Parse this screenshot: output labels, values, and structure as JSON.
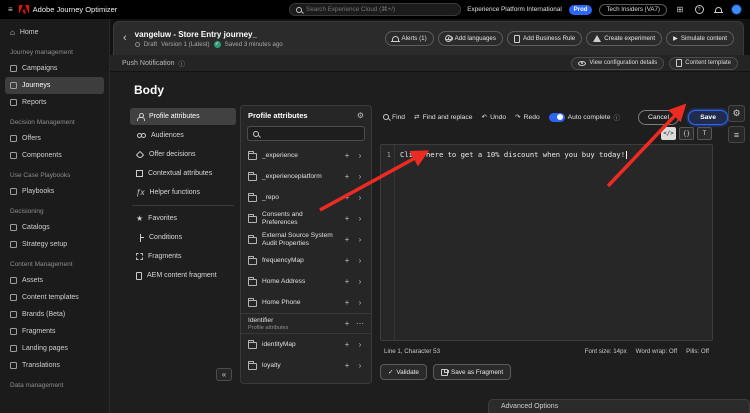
{
  "colors": {
    "accent_blue": "#2b66f6",
    "positive_green": "#2d9d78",
    "annotation_red": "#ee2b22",
    "adobe_red": "#eb1000"
  },
  "icons": {
    "menu": "≡",
    "apps": "⊞",
    "help": "?",
    "back": "‹",
    "chevron_right": "›",
    "collapse": "«",
    "plus": "+",
    "more": "⋯",
    "gear": "⚙",
    "star": "★",
    "info": "ⓘ",
    "home": "⌂",
    "undo": "↶",
    "redo": "↷",
    "check": "✓",
    "play": "▶",
    "swap": "⇄",
    "fx": "ƒx",
    "dot": "•"
  },
  "topbar": {
    "app_title": "Adobe Journey Optimizer",
    "search_placeholder": "Search Experience Cloud (⌘+/)",
    "org": "Experience Platform International",
    "env_badge": "Prod",
    "tenant": "Tech Insiders (VA7)"
  },
  "sidebar": {
    "items": [
      "Home",
      "Journey management",
      "Campaigns",
      "Journeys",
      "Reports",
      "Decision Management",
      "Offers",
      "Components",
      "Use Case Playbooks",
      "Playbooks",
      "Decisioning",
      "Catalogs",
      "Strategy setup",
      "Content Management",
      "Assets",
      "Content templates",
      "Brands (Beta)",
      "Fragments",
      "Landing pages",
      "Translations",
      "Data management"
    ]
  },
  "journey": {
    "title": "vangeluw - Store Entry journey_",
    "status": "Draft",
    "version": "Version 1 (Latest)",
    "saved": "Saved 3 minutes ago",
    "alerts": "Alerts (1)",
    "add_languages": "Add languages",
    "add_business_rule": "Add Business Rule",
    "create_experiment": "Create experiment",
    "simulate_content": "Simulate content"
  },
  "push_bar": {
    "title": "Push Notification",
    "view_config": "View configuration details",
    "content_template": "Content template"
  },
  "body_panel": {
    "title": "Body",
    "cancel": "Cancel",
    "save": "Save"
  },
  "palette": {
    "items": [
      "Profile attributes",
      "Audiences",
      "Offer decisions",
      "Contextual attributes",
      "Helper functions",
      "Favorites",
      "Conditions",
      "Fragments",
      "AEM content fragment"
    ]
  },
  "attributes": {
    "title": "Profile attributes",
    "rows": [
      {
        "name": "_experience"
      },
      {
        "name": "_experienceplatform"
      },
      {
        "name": "_repo"
      },
      {
        "name": "Consents and Preferences"
      },
      {
        "name": "External Source System Audit Properties"
      },
      {
        "name": "frequencyMap"
      },
      {
        "name": "Home Address"
      },
      {
        "name": "Home Phone"
      },
      {
        "name": "Identifier",
        "subtitle": "Profile attributes"
      },
      {
        "name": "identityMap"
      },
      {
        "name": "loyalty"
      }
    ]
  },
  "editor": {
    "find": "Find",
    "find_replace": "Find and replace",
    "undo": "Undo",
    "redo": "Redo",
    "autocomplete": "Auto complete",
    "mode_code": "</>",
    "mode_braces": "{}",
    "mode_text": "T",
    "line_number": "1",
    "code": "Click here to get a 10% discount when you buy today!",
    "status_position": "Line 1, Character 53",
    "status_font": "Font size: 14px",
    "status_wrap": "Word wrap: Off",
    "status_pills": "Pills: Off",
    "validate": "Validate",
    "save_fragment": "Save as Fragment"
  },
  "advanced": {
    "title": "Advanced Options"
  }
}
